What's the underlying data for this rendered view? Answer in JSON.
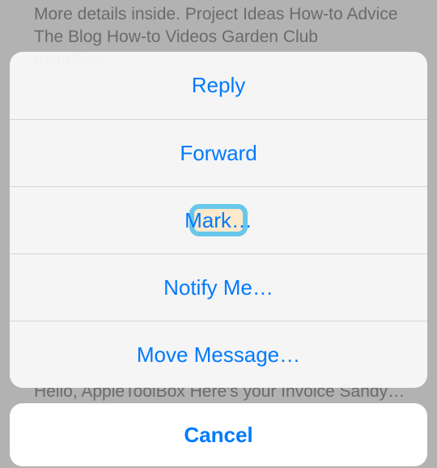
{
  "backdrop": {
    "top_text": "More details inside. Project Ideas How-to Advice The Blog How-to Videos Garden Club Installing…",
    "bottom_text": "Hello, AppleToolBox Here's your Invoice Sandy…"
  },
  "action_sheet": {
    "items": [
      {
        "label": "Reply",
        "highlighted": false
      },
      {
        "label": "Forward",
        "highlighted": false
      },
      {
        "label": "Mark…",
        "highlighted": true
      },
      {
        "label": "Notify Me…",
        "highlighted": false
      },
      {
        "label": "Move Message…",
        "highlighted": false
      }
    ]
  },
  "cancel": {
    "label": "Cancel"
  },
  "colors": {
    "ios_blue": "#007aff",
    "highlight_border": "#67c7eb",
    "highlight_fill": "#fce9cc"
  }
}
